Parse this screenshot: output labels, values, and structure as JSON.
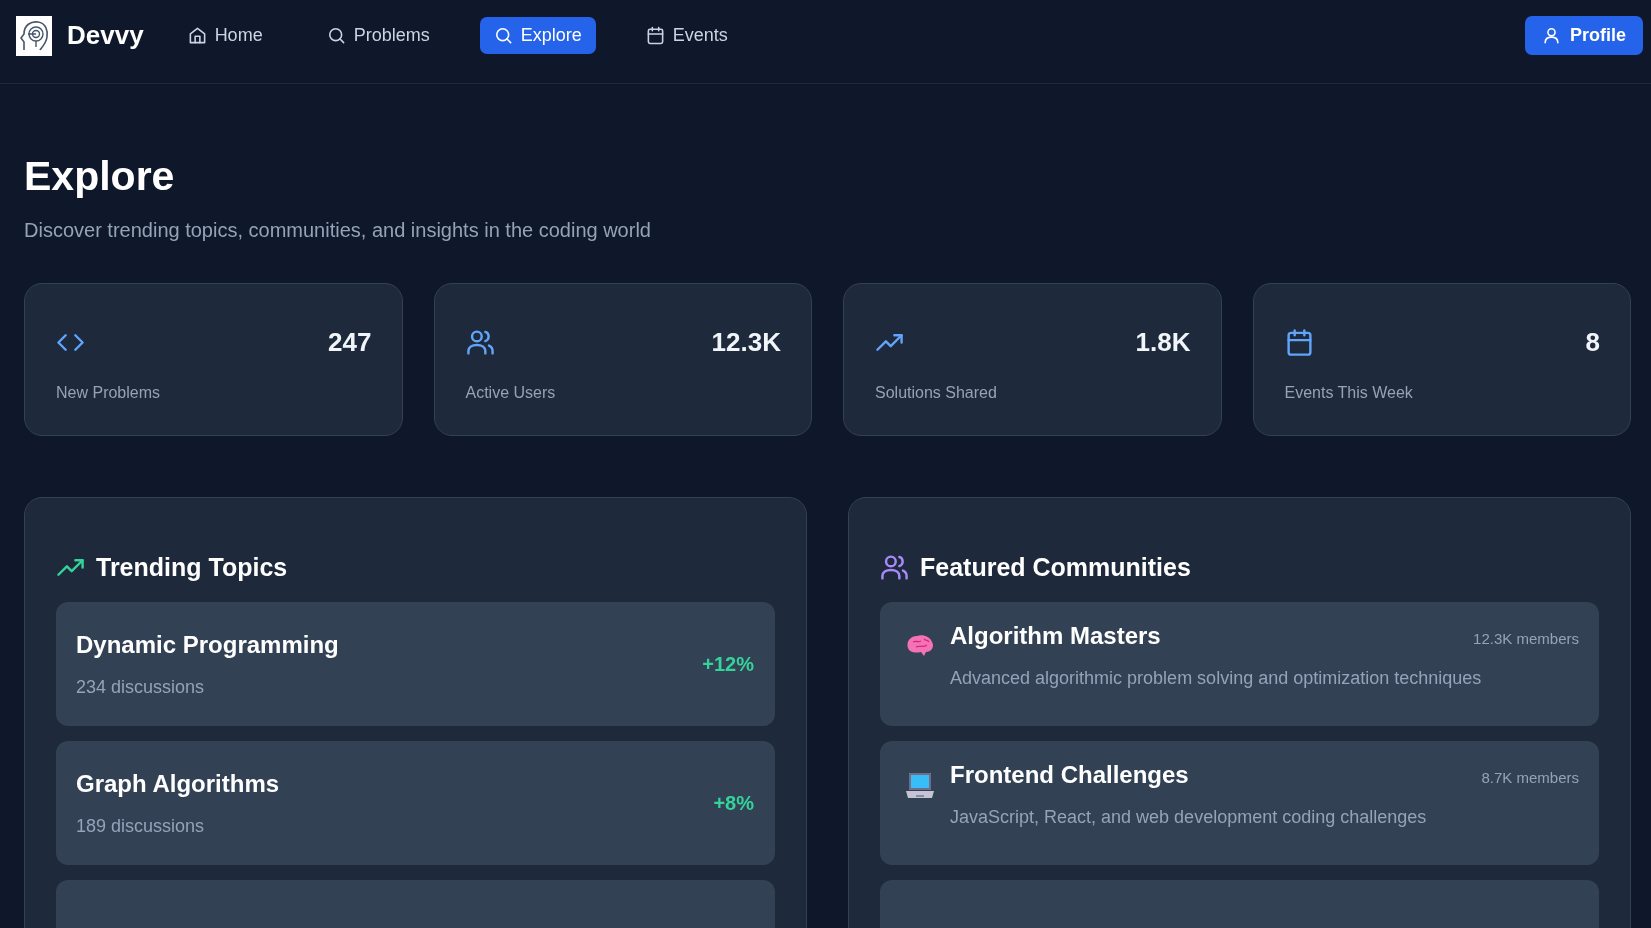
{
  "nav": {
    "brand": "Devvy",
    "links": [
      {
        "label": "Home",
        "kind": "home",
        "selected": false
      },
      {
        "label": "Problems",
        "kind": "search",
        "selected": false
      },
      {
        "label": "Explore",
        "kind": "search",
        "selected": true
      },
      {
        "label": "Events",
        "kind": "calendar",
        "selected": false
      }
    ],
    "profile": "Profile"
  },
  "header": {
    "title": "Explore",
    "subtitle": "Discover trending topics, communities, and insights in the coding world"
  },
  "stats": [
    {
      "kind": "code",
      "value": "247",
      "label": "New Problems"
    },
    {
      "kind": "users",
      "value": "12.3K",
      "label": "Active Users"
    },
    {
      "kind": "trend",
      "value": "1.8K",
      "label": "Solutions Shared"
    },
    {
      "kind": "calendar",
      "value": "8",
      "label": "Events This Week"
    }
  ],
  "trending": {
    "title": "Trending Topics",
    "topics": [
      {
        "name": "Dynamic Programming",
        "discussions": "234 discussions",
        "change": "+12%"
      },
      {
        "name": "Graph Algorithms",
        "discussions": "189 discussions",
        "change": "+8%"
      }
    ]
  },
  "communities": {
    "title": "Featured Communities",
    "items": [
      {
        "kind": "brain",
        "name": "Algorithm Masters",
        "members": "12.3K members",
        "description": "Advanced algorithmic problem solving and optimization techniques"
      },
      {
        "kind": "laptop",
        "name": "Frontend Challenges",
        "members": "8.7K members",
        "description": "JavaScript, React, and web development coding challenges"
      }
    ]
  }
}
